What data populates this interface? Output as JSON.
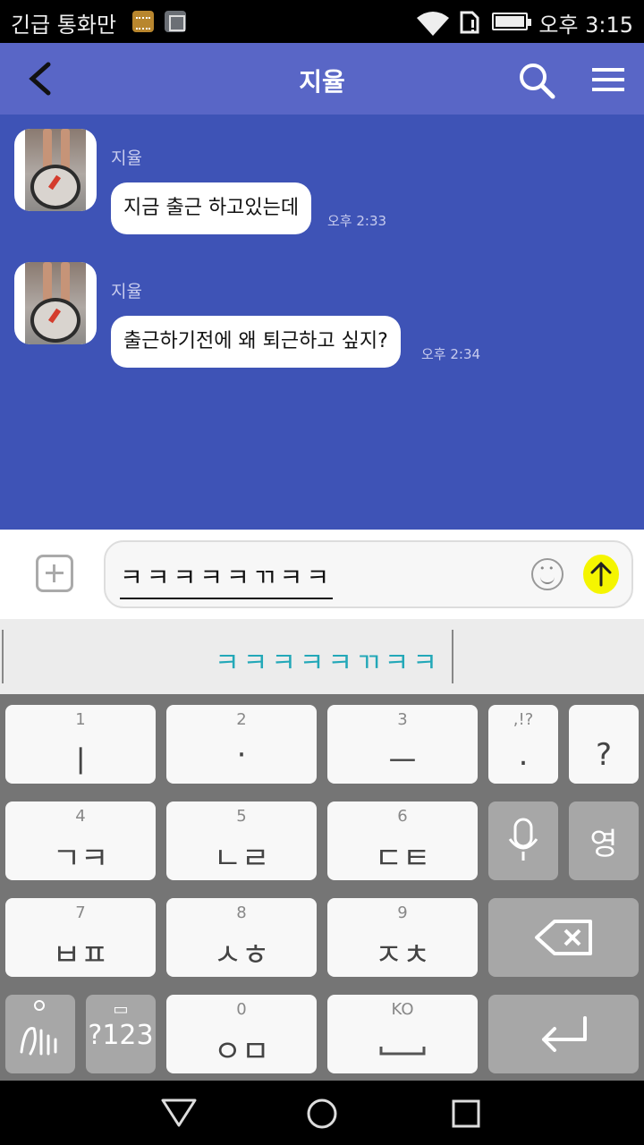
{
  "status_bar": {
    "carrier_text": "긴급 통화만",
    "clock": "오후 3:15"
  },
  "header": {
    "title": "지율",
    "icons": [
      "back-icon",
      "search-icon",
      "menu-icon"
    ]
  },
  "messages": [
    {
      "sender": "지율",
      "text": "지금 출근 하고있는데",
      "time": "오후 2:33"
    },
    {
      "sender": "지율",
      "text": "출근하기전에 왜 퇴근하고 싶지?",
      "time": "오후 2:34"
    }
  ],
  "composer": {
    "text": "ㅋㅋㅋㅋㅋㄲㅋㅋ",
    "icons": [
      "add-icon",
      "emoji-icon",
      "send-icon"
    ]
  },
  "suggestion": {
    "word": "ㅋㅋㅋㅋㅋㄲㅋㅋ"
  },
  "keyboard": {
    "row1": [
      {
        "num": "1",
        "label": "ㅣ"
      },
      {
        "num": "2",
        "label": "·"
      },
      {
        "num": "3",
        "label": "ㅡ"
      },
      {
        "num": ",!?",
        "label": "."
      },
      {
        "num": "",
        "label": "?"
      }
    ],
    "row2": [
      {
        "num": "4",
        "label": "ㄱㅋ"
      },
      {
        "num": "5",
        "label": "ㄴㄹ"
      },
      {
        "num": "6",
        "label": "ㄷㅌ"
      },
      {
        "num": "",
        "label": ""
      },
      {
        "num": "",
        "label": "영"
      }
    ],
    "row3": [
      {
        "num": "7",
        "label": "ㅂㅍ"
      },
      {
        "num": "8",
        "label": "ㅅㅎ"
      },
      {
        "num": "9",
        "label": "ㅈㅊ"
      }
    ],
    "row4": [
      {
        "num": "",
        "label": ""
      },
      {
        "num": "",
        "label": "?123"
      },
      {
        "num": "0",
        "label": "ㅇㅁ"
      },
      {
        "num": "KO",
        "label": ""
      }
    ]
  },
  "colors": {
    "header": "#5966c6",
    "chat_bg": "#3e53b6",
    "suggestion_text": "#23a8b8",
    "send_highlight": "#f5f500"
  }
}
